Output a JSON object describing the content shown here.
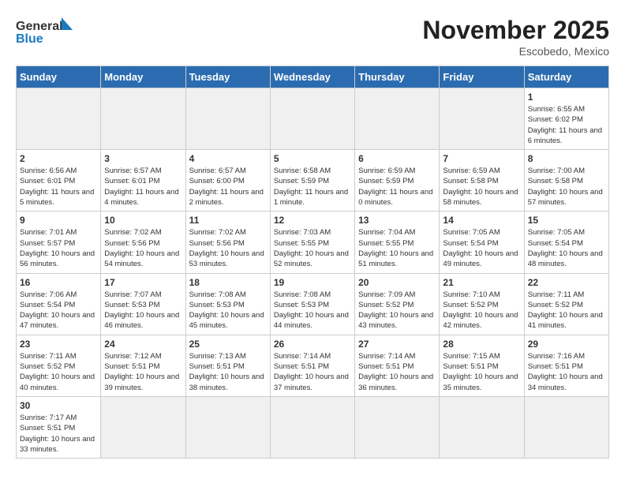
{
  "header": {
    "logo_general": "General",
    "logo_blue": "Blue",
    "month_title": "November 2025",
    "subtitle": "Escobedo, Mexico"
  },
  "days_of_week": [
    "Sunday",
    "Monday",
    "Tuesday",
    "Wednesday",
    "Thursday",
    "Friday",
    "Saturday"
  ],
  "weeks": [
    [
      {
        "day": "",
        "info": ""
      },
      {
        "day": "",
        "info": ""
      },
      {
        "day": "",
        "info": ""
      },
      {
        "day": "",
        "info": ""
      },
      {
        "day": "",
        "info": ""
      },
      {
        "day": "",
        "info": ""
      },
      {
        "day": "1",
        "info": "Sunrise: 6:55 AM\nSunset: 6:02 PM\nDaylight: 11 hours and 6 minutes."
      }
    ],
    [
      {
        "day": "2",
        "info": "Sunrise: 6:56 AM\nSunset: 6:01 PM\nDaylight: 11 hours and 5 minutes."
      },
      {
        "day": "3",
        "info": "Sunrise: 6:57 AM\nSunset: 6:01 PM\nDaylight: 11 hours and 4 minutes."
      },
      {
        "day": "4",
        "info": "Sunrise: 6:57 AM\nSunset: 6:00 PM\nDaylight: 11 hours and 2 minutes."
      },
      {
        "day": "5",
        "info": "Sunrise: 6:58 AM\nSunset: 5:59 PM\nDaylight: 11 hours and 1 minute."
      },
      {
        "day": "6",
        "info": "Sunrise: 6:59 AM\nSunset: 5:59 PM\nDaylight: 11 hours and 0 minutes."
      },
      {
        "day": "7",
        "info": "Sunrise: 6:59 AM\nSunset: 5:58 PM\nDaylight: 10 hours and 58 minutes."
      },
      {
        "day": "8",
        "info": "Sunrise: 7:00 AM\nSunset: 5:58 PM\nDaylight: 10 hours and 57 minutes."
      }
    ],
    [
      {
        "day": "9",
        "info": "Sunrise: 7:01 AM\nSunset: 5:57 PM\nDaylight: 10 hours and 56 minutes."
      },
      {
        "day": "10",
        "info": "Sunrise: 7:02 AM\nSunset: 5:56 PM\nDaylight: 10 hours and 54 minutes."
      },
      {
        "day": "11",
        "info": "Sunrise: 7:02 AM\nSunset: 5:56 PM\nDaylight: 10 hours and 53 minutes."
      },
      {
        "day": "12",
        "info": "Sunrise: 7:03 AM\nSunset: 5:55 PM\nDaylight: 10 hours and 52 minutes."
      },
      {
        "day": "13",
        "info": "Sunrise: 7:04 AM\nSunset: 5:55 PM\nDaylight: 10 hours and 51 minutes."
      },
      {
        "day": "14",
        "info": "Sunrise: 7:05 AM\nSunset: 5:54 PM\nDaylight: 10 hours and 49 minutes."
      },
      {
        "day": "15",
        "info": "Sunrise: 7:05 AM\nSunset: 5:54 PM\nDaylight: 10 hours and 48 minutes."
      }
    ],
    [
      {
        "day": "16",
        "info": "Sunrise: 7:06 AM\nSunset: 5:54 PM\nDaylight: 10 hours and 47 minutes."
      },
      {
        "day": "17",
        "info": "Sunrise: 7:07 AM\nSunset: 5:53 PM\nDaylight: 10 hours and 46 minutes."
      },
      {
        "day": "18",
        "info": "Sunrise: 7:08 AM\nSunset: 5:53 PM\nDaylight: 10 hours and 45 minutes."
      },
      {
        "day": "19",
        "info": "Sunrise: 7:08 AM\nSunset: 5:53 PM\nDaylight: 10 hours and 44 minutes."
      },
      {
        "day": "20",
        "info": "Sunrise: 7:09 AM\nSunset: 5:52 PM\nDaylight: 10 hours and 43 minutes."
      },
      {
        "day": "21",
        "info": "Sunrise: 7:10 AM\nSunset: 5:52 PM\nDaylight: 10 hours and 42 minutes."
      },
      {
        "day": "22",
        "info": "Sunrise: 7:11 AM\nSunset: 5:52 PM\nDaylight: 10 hours and 41 minutes."
      }
    ],
    [
      {
        "day": "23",
        "info": "Sunrise: 7:11 AM\nSunset: 5:52 PM\nDaylight: 10 hours and 40 minutes."
      },
      {
        "day": "24",
        "info": "Sunrise: 7:12 AM\nSunset: 5:51 PM\nDaylight: 10 hours and 39 minutes."
      },
      {
        "day": "25",
        "info": "Sunrise: 7:13 AM\nSunset: 5:51 PM\nDaylight: 10 hours and 38 minutes."
      },
      {
        "day": "26",
        "info": "Sunrise: 7:14 AM\nSunset: 5:51 PM\nDaylight: 10 hours and 37 minutes."
      },
      {
        "day": "27",
        "info": "Sunrise: 7:14 AM\nSunset: 5:51 PM\nDaylight: 10 hours and 36 minutes."
      },
      {
        "day": "28",
        "info": "Sunrise: 7:15 AM\nSunset: 5:51 PM\nDaylight: 10 hours and 35 minutes."
      },
      {
        "day": "29",
        "info": "Sunrise: 7:16 AM\nSunset: 5:51 PM\nDaylight: 10 hours and 34 minutes."
      }
    ],
    [
      {
        "day": "30",
        "info": "Sunrise: 7:17 AM\nSunset: 5:51 PM\nDaylight: 10 hours and 33 minutes."
      },
      {
        "day": "",
        "info": ""
      },
      {
        "day": "",
        "info": ""
      },
      {
        "day": "",
        "info": ""
      },
      {
        "day": "",
        "info": ""
      },
      {
        "day": "",
        "info": ""
      },
      {
        "day": "",
        "info": ""
      }
    ]
  ]
}
